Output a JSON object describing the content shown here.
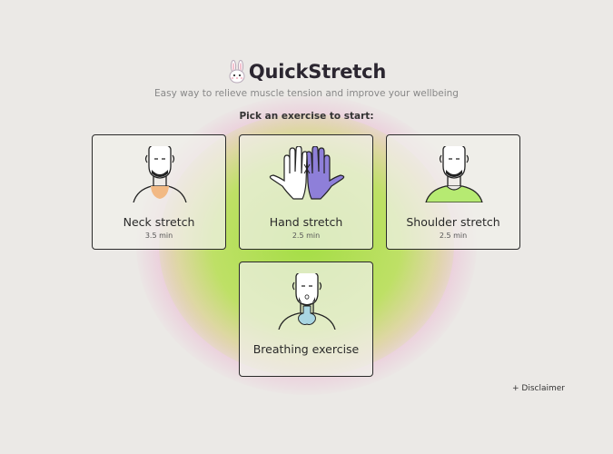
{
  "app": {
    "title": "QuickStretch",
    "subtitle": "Easy way to relieve muscle tension and improve your wellbeing",
    "prompt": "Pick an exercise to start:"
  },
  "exercises": [
    {
      "title": "Neck stretch",
      "duration": "3.5 min",
      "icon": "neck-stretch-illustration",
      "accent": "#f2b984"
    },
    {
      "title": "Hand stretch",
      "duration": "2.5 min",
      "icon": "hands-illustration",
      "accent": "#8e7fd9"
    },
    {
      "title": "Shoulder stretch",
      "duration": "2.5 min",
      "icon": "shoulder-stretch-illustration",
      "accent": "#b6ea72"
    },
    {
      "title": "Breathing exercise",
      "icon": "breathing-illustration",
      "accent": "#a9d6e2"
    }
  ],
  "footer": {
    "disclaimer": "+ Disclaimer"
  },
  "colors": {
    "background": "#ebe9e6",
    "blob_green": "#a5de46",
    "blob_pink": "#ecaacd"
  }
}
